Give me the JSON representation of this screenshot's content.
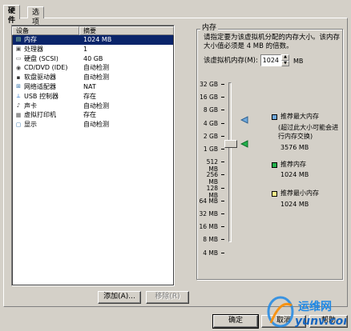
{
  "tabs": [
    {
      "label": "硬件",
      "active": true
    },
    {
      "label": "选项",
      "active": false
    }
  ],
  "device_list": {
    "headers": [
      "设备",
      "摘要"
    ],
    "rows": [
      {
        "icon": "memory-icon",
        "device": "内存",
        "summary": "1024 MB",
        "selected": true
      },
      {
        "icon": "cpu-icon",
        "device": "处理器",
        "summary": "1",
        "selected": false
      },
      {
        "icon": "harddisk-icon",
        "device": "硬盘 (SCSI)",
        "summary": "40 GB",
        "selected": false
      },
      {
        "icon": "cdrom-icon",
        "device": "CD/DVD (IDE)",
        "summary": "自动检测",
        "selected": false
      },
      {
        "icon": "floppy-icon",
        "device": "软盘驱动器",
        "summary": "自动检测",
        "selected": false
      },
      {
        "icon": "network-adapter-icon",
        "device": "网络适配器",
        "summary": "NAT",
        "selected": false
      },
      {
        "icon": "usb-icon",
        "device": "USB 控制器",
        "summary": "存在",
        "selected": false
      },
      {
        "icon": "speaker-icon",
        "device": "声卡",
        "summary": "自动检测",
        "selected": false
      },
      {
        "icon": "printer-icon",
        "device": "虚拟打印机",
        "summary": "存在",
        "selected": false
      },
      {
        "icon": "monitor-icon",
        "device": "显示",
        "summary": "自动检测",
        "selected": false
      }
    ]
  },
  "buttons": {
    "add": "添加(A)...",
    "remove": "移除(R)",
    "ok": "确定",
    "cancel": "取消",
    "help": "帮助"
  },
  "memory": {
    "title": "内存",
    "description": "请指定要为该虚拟机分配的内存大小。该内存大小值必须是 4 MB 的倍数。",
    "label": "该虚拟机内存(M):",
    "value": "1024",
    "unit": "MB",
    "scale": [
      "32 GB",
      "16 GB",
      "8 GB",
      "4 GB",
      "2 GB",
      "1 GB",
      "512 MB",
      "256 MB",
      "128 MB",
      "64 MB",
      "32 MB",
      "16 MB",
      "8 MB",
      "4 MB"
    ],
    "max_recommended": {
      "label": "推荐最大内存",
      "note": "(超过此大小可能会进行内存交换)",
      "value": "3576 MB",
      "color": "#6fa8dc"
    },
    "recommended": {
      "label": "推荐内存",
      "value": "1024 MB",
      "color": "#22b14c"
    },
    "min_recommended": {
      "label": "推荐最小内存",
      "value": "1024 MB",
      "color": "#fff38a"
    }
  },
  "watermark": {
    "text": "运维网",
    "url": "yunv.com"
  }
}
